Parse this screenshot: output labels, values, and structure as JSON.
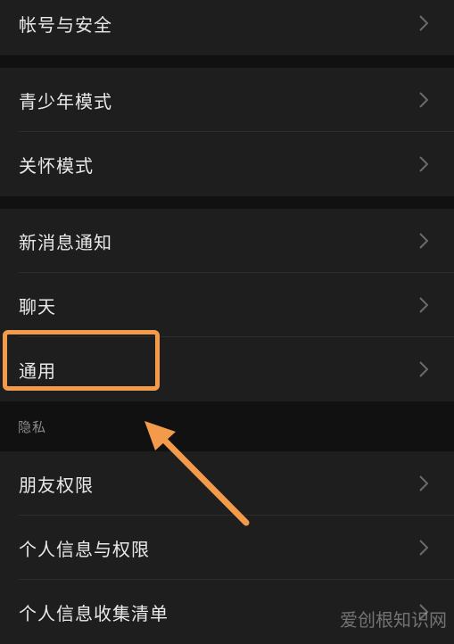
{
  "groups": [
    {
      "items": [
        {
          "label": "帐号与安全"
        }
      ]
    },
    {
      "items": [
        {
          "label": "青少年模式"
        },
        {
          "label": "关怀模式"
        }
      ]
    },
    {
      "items": [
        {
          "label": "新消息通知"
        },
        {
          "label": "聊天"
        },
        {
          "label": "通用"
        }
      ]
    }
  ],
  "privacy": {
    "header": "隐私",
    "items": [
      {
        "label": "朋友权限"
      },
      {
        "label": "个人信息与权限"
      },
      {
        "label": "个人信息收集清单"
      }
    ]
  },
  "annotation": {
    "color": "#f39b4a"
  },
  "watermark": "爱创根知识网",
  "icons": {
    "chevron": "chevron-right-icon"
  }
}
